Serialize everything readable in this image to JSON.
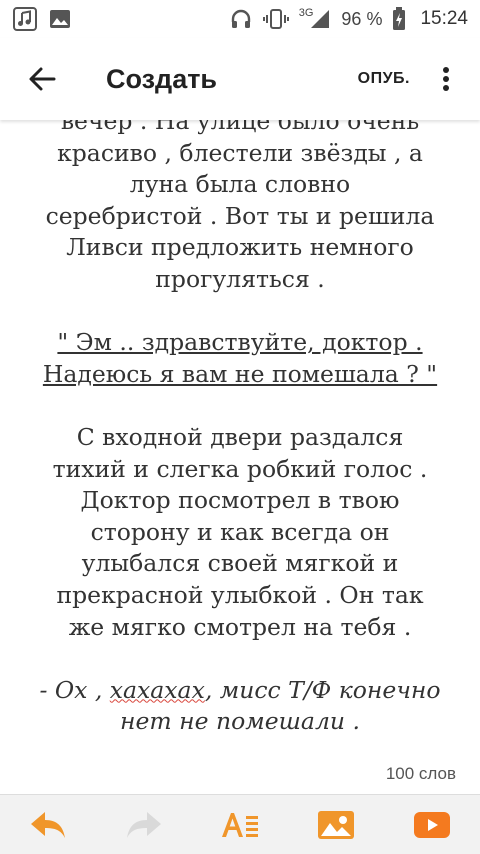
{
  "status_bar": {
    "network_label": "3G",
    "battery_percent": "96 %",
    "time": "15:24"
  },
  "app_bar": {
    "title": "Создать",
    "publish_label": "ОПУБ."
  },
  "story": {
    "para1_lines": [
      "вечер . На улице было очень",
      "красиво , блестели звёзды , а",
      "луна была словно",
      "серебристой . Вот ты и решила",
      "Ливси предложить немного",
      "прогуляться ."
    ],
    "para2_lines": [
      "\" Эм .. здравствуйте, доктор .",
      "Надеюсь я вам не помешала ? \""
    ],
    "para3_lines": [
      "С входной двери раздался",
      "тихий и слегка робкий голос .",
      "Доктор посмотрел в твою",
      "сторону и как всегда он",
      "улыбался своей мягкой и",
      "прекрасной улыбкой . Он так",
      "же мягко смотрел на тебя ."
    ],
    "para4_prefix": "- Ох , ",
    "para4_misspelled": "хахахах",
    "para4_suffix": ", мисс Т/Ф конечно",
    "para4_line2": "нет не помешали ."
  },
  "word_count": "100 слов",
  "colors": {
    "toolbar_accent": "#f0962b",
    "toolbar_disabled": "#d9d9d9",
    "video_icon": "#f47a1f"
  }
}
